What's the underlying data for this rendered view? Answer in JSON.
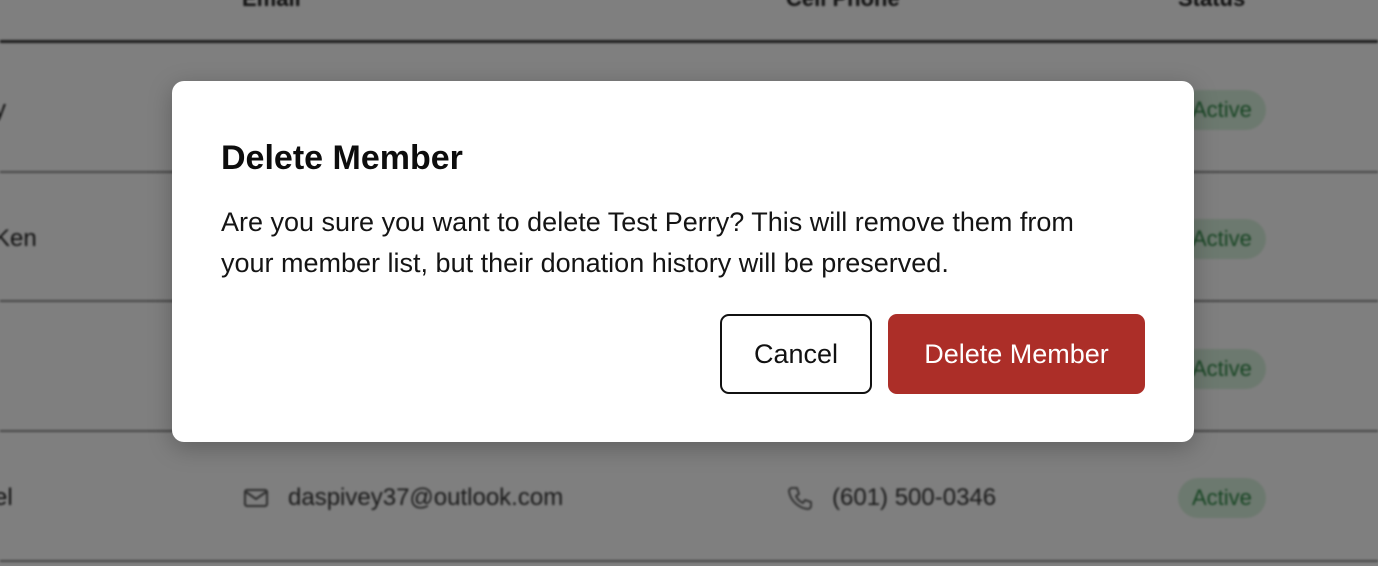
{
  "table": {
    "headers": {
      "email": "Email",
      "phone": "Cell Phone",
      "status": "Status"
    },
    "rows": [
      {
        "name": "y",
        "email": "",
        "phone": "",
        "status": "Active"
      },
      {
        "name": "Ken",
        "email": "",
        "phone": "",
        "status": "Active"
      },
      {
        "name": "",
        "email": "",
        "phone": "",
        "status": "Active"
      },
      {
        "name": "el",
        "email": "daspivey37@outlook.com",
        "phone": "(601) 500-0346",
        "status": "Active"
      }
    ]
  },
  "modal": {
    "title": "Delete Member",
    "message": "Are you sure you want to delete Test Perry? This will remove them from your member list, but their donation history will be preserved.",
    "cancel_label": "Cancel",
    "confirm_label": "Delete Member"
  },
  "colors": {
    "confirm_button": "#ac2e28",
    "badge_bg": "#d9f2de",
    "badge_text": "#2f8a47"
  },
  "icons": {
    "email": "mail-icon",
    "phone": "phone-icon"
  }
}
